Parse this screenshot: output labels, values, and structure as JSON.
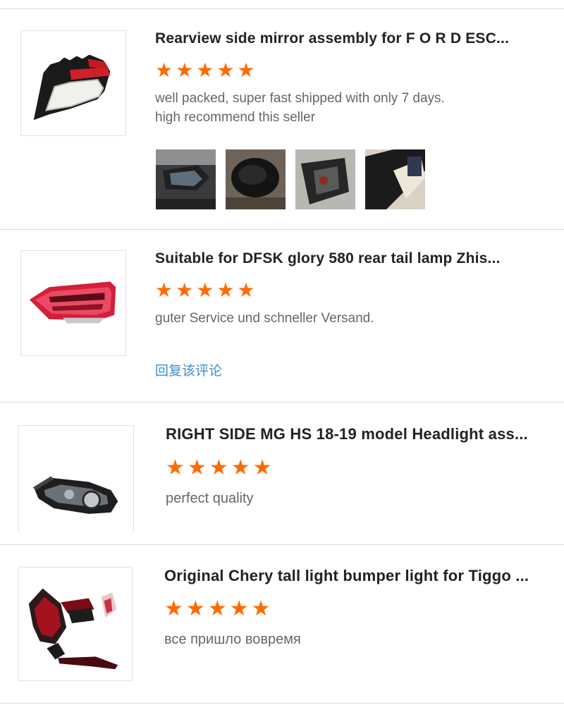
{
  "reviews": [
    {
      "title": "Rearview side mirror assembly for F O R D ESC...",
      "rating": 5,
      "text_lines": [
        "well packed, super fast shipped with only 7 days.",
        "high recommend this seller"
      ],
      "product_icon": "side-mirror",
      "photo_icons": [
        "mirror-photo-1",
        "mirror-photo-2",
        "mirror-photo-3",
        "mirror-photo-4"
      ]
    },
    {
      "title": "Suitable for DFSK glory 580 rear tail lamp Zhis...",
      "rating": 5,
      "text_lines": [
        "guter Service und schneller Versand."
      ],
      "reply_label": "回复该评论",
      "product_icon": "tail-lamp"
    },
    {
      "title": "RIGHT SIDE MG HS 18-19 model Headlight ass...",
      "rating": 5,
      "text_lines": [
        "perfect quality"
      ],
      "product_icon": "headlight"
    },
    {
      "title": "Original Chery tall light bumper light for Tiggo ...",
      "rating": 5,
      "text_lines": [
        "все пришло вовремя"
      ],
      "product_icon": "tail-light-set"
    }
  ],
  "colors": {
    "star": "#ff6a00",
    "reply_link": "#3e8ed0",
    "divider": "#dcdcdc"
  }
}
